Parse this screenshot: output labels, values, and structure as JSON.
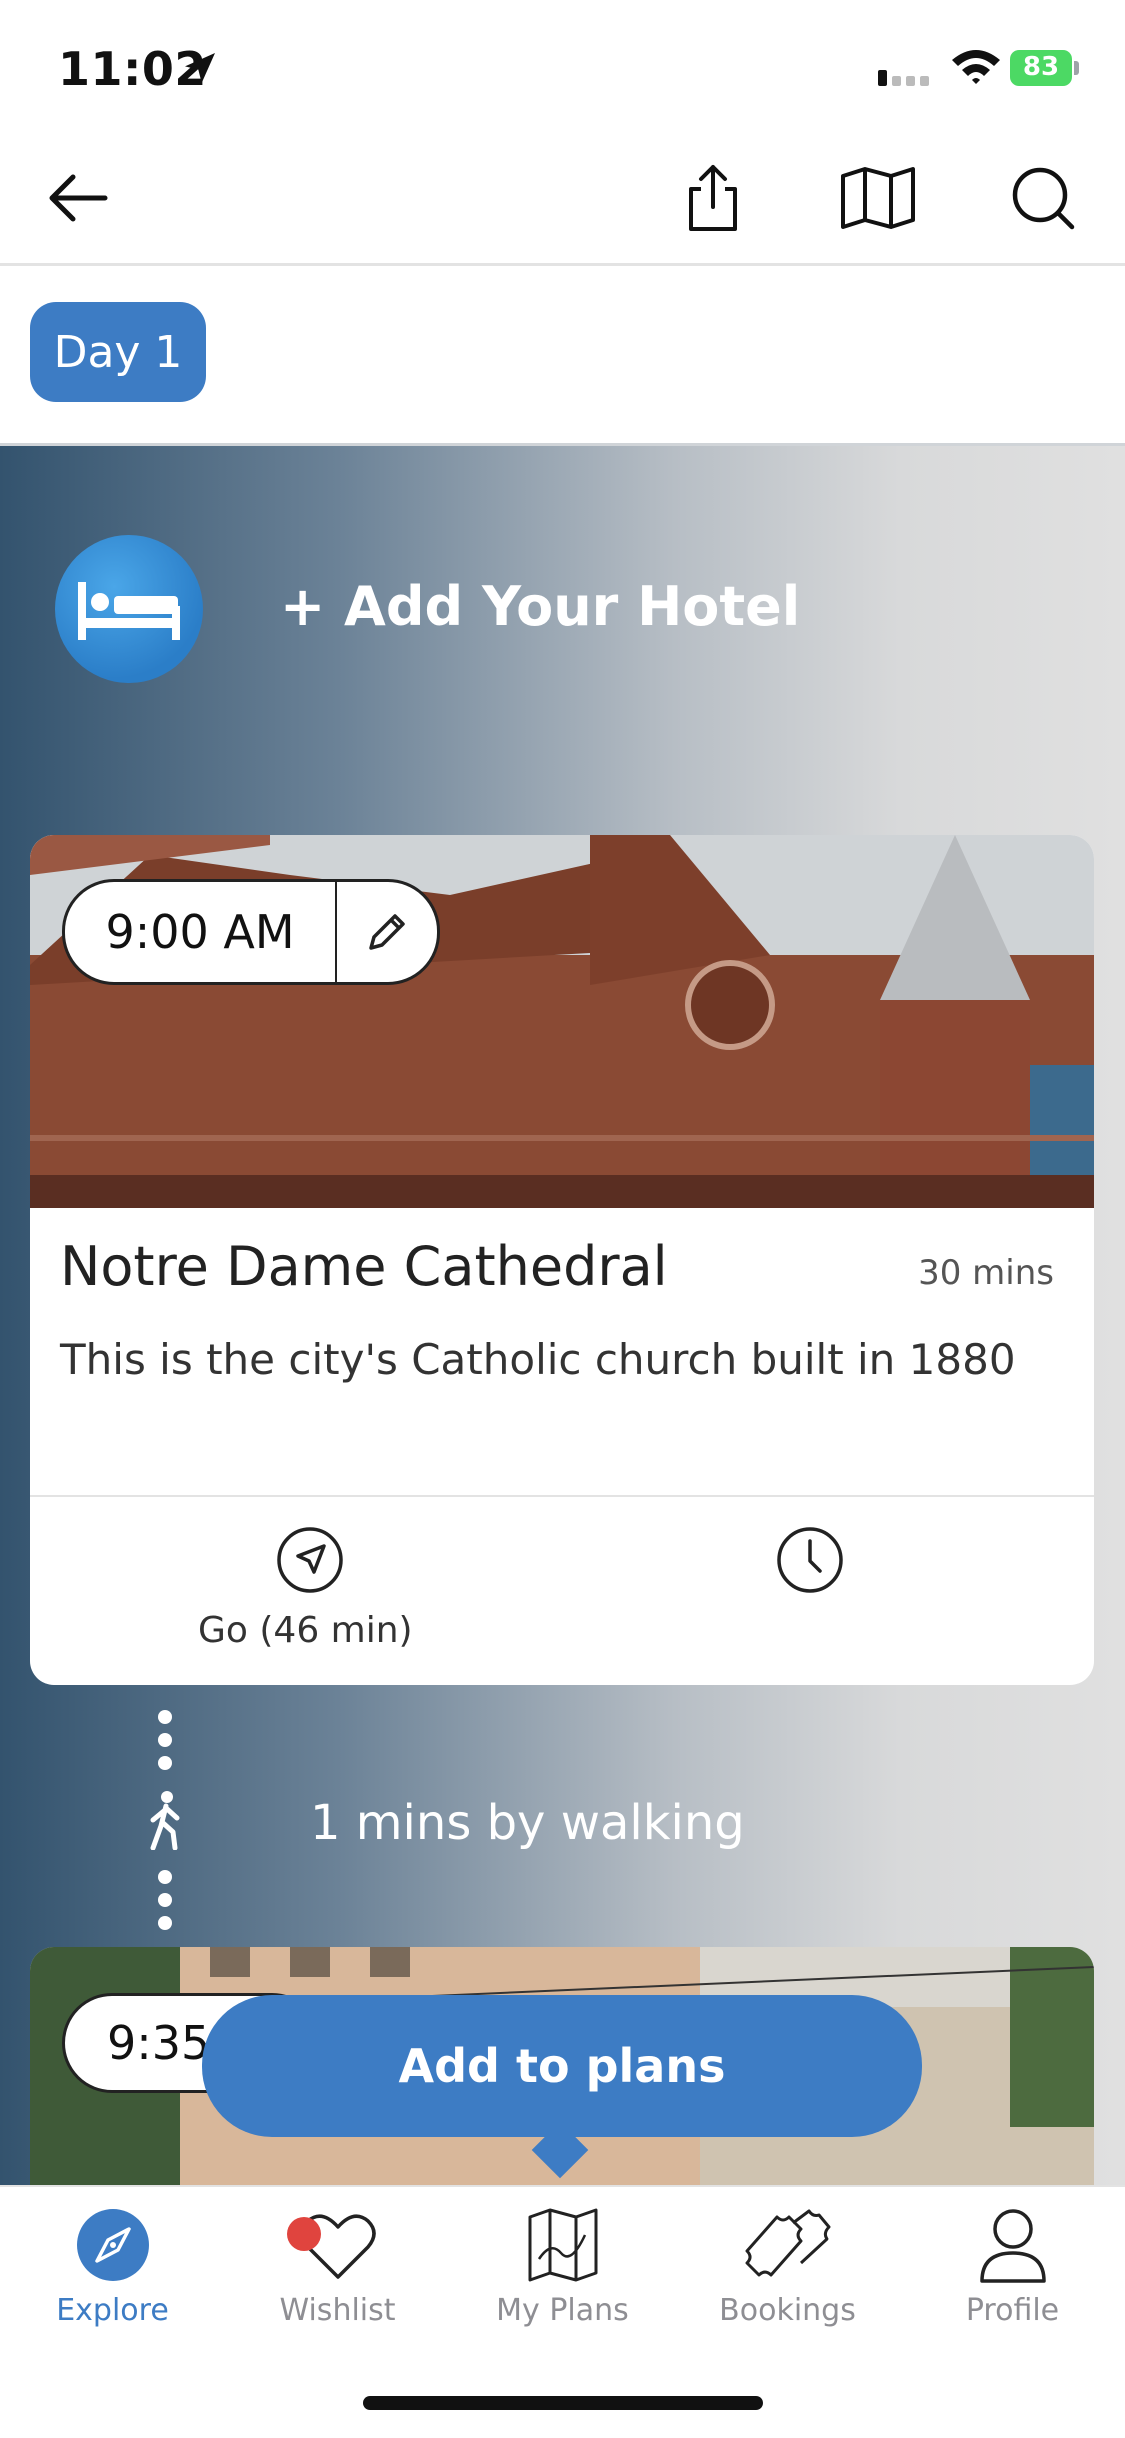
{
  "status_bar": {
    "time": "11:02",
    "battery": "83"
  },
  "header": {
    "back_icon": "arrow-left-icon",
    "actions": [
      "share-icon",
      "map-icon",
      "search-icon"
    ]
  },
  "day_tab": {
    "label": "Day 1"
  },
  "hotel": {
    "label": "+ Add Your Hotel",
    "icon": "bed-icon"
  },
  "stop1": {
    "time": "9:00 AM",
    "title": "Notre Dame Cathedral",
    "duration": "30 mins",
    "description": "This is the city's Catholic church built in 1880",
    "go_label": "Go (46 min)"
  },
  "transit": {
    "label": "1 mins by walking"
  },
  "stop2": {
    "time": "9:35"
  },
  "cta": {
    "label": "Add to plans"
  },
  "tabs": [
    {
      "label": "Explore",
      "icon": "compass-icon",
      "active": true
    },
    {
      "label": "Wishlist",
      "icon": "heart-icon"
    },
    {
      "label": "My Plans",
      "icon": "folded-map-icon"
    },
    {
      "label": "Bookings",
      "icon": "tickets-icon"
    },
    {
      "label": "Profile",
      "icon": "person-icon"
    }
  ],
  "colors": {
    "accent": "#3d7cc4",
    "badge": "#e0443e",
    "battery": "#4cd964"
  }
}
